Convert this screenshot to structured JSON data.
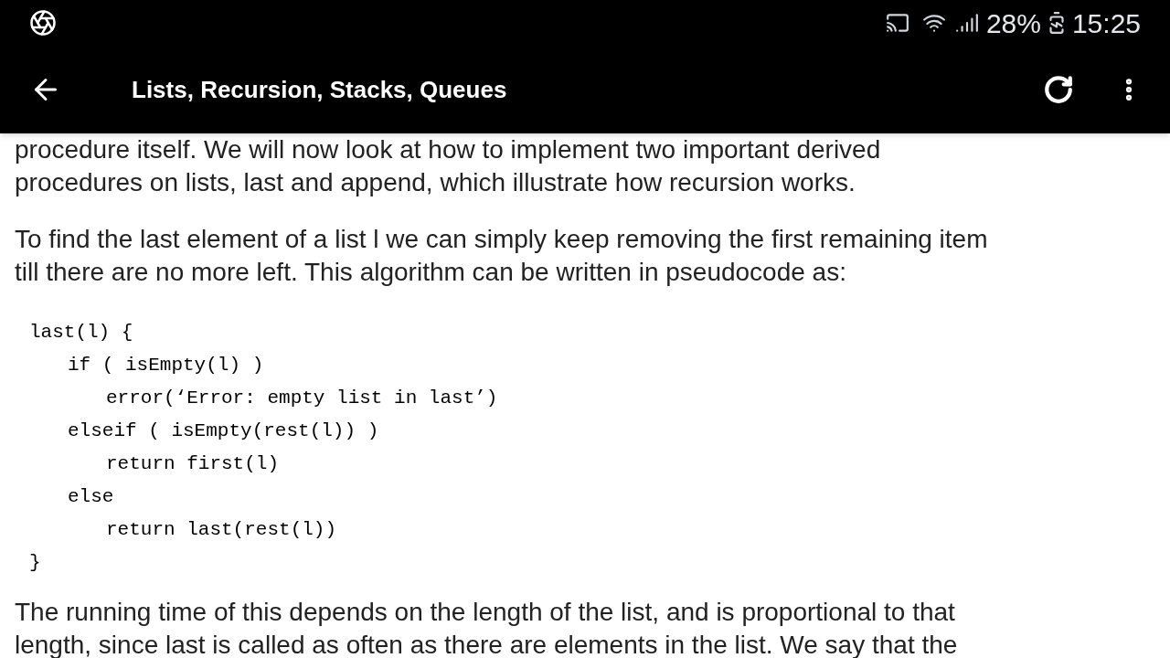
{
  "status_bar": {
    "battery": "28%",
    "time": "15:25"
  },
  "app_bar": {
    "title": "Lists, Recursion, Stacks, Queues"
  },
  "paragraphs_top": [
    {
      "lines": [
        "procedure itself. We will now look at how to implement two important derived",
        "procedures on lists, last and append, which illustrate how recursion works."
      ]
    },
    {
      "lines": [
        "To find the last element of a list l we can simply keep removing the first remaining item",
        "till there are no more left. This algorithm can be written in pseudocode as:"
      ]
    }
  ],
  "code": [
    {
      "text": "last(l) {",
      "children": [
        {
          "text": "if ( isEmpty(l) )",
          "children": [
            {
              "text": "error(‘Error: empty list in last’)"
            }
          ]
        },
        {
          "text": "elseif ( isEmpty(rest(l)) )",
          "children": [
            {
              "text": "return first(l)"
            }
          ]
        },
        {
          "text": "else",
          "children": [
            {
              "text": "return last(rest(l))"
            }
          ]
        }
      ]
    },
    {
      "text": "}"
    }
  ],
  "paragraphs_bottom": [
    {
      "lines": [
        "The running time of this depends on the length of the list, and is proportional to that",
        "length, since last is called as often as there are elements in the list. We say that the"
      ]
    }
  ]
}
